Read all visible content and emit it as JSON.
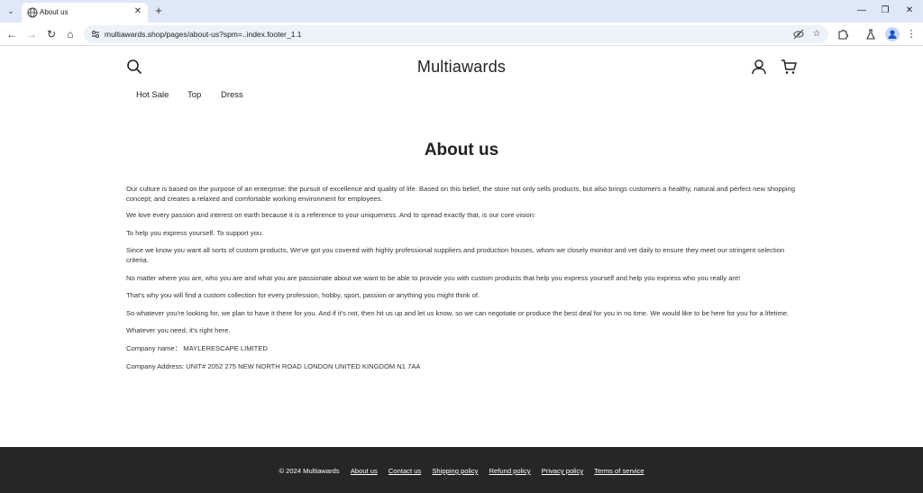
{
  "browser": {
    "tab": {
      "title": "About us"
    },
    "url": "multiawards.shop/pages/about-us?spm=..index.footer_1.1"
  },
  "header": {
    "store_name": "Multiawards",
    "nav": [
      "Hot Sale",
      "Top",
      "Dress"
    ]
  },
  "page": {
    "title": "About us",
    "paragraphs": [
      "Our culture is based on the purpose of an enterprise: the pursuit of excellence and quality of life. Based on this belief, the store not only sells products, but also brings customers a healthy, natural and perfect new shopping concept; and creates a relaxed and comfortable working environment for employees.",
      "We love every passion and interest on earth because it is a reference to your uniqueness. And to spread exactly that, is our core vision:",
      "To help you express yourself. To support you.",
      "Since we know you want all sorts of custom products, We've got you covered with highly professional suppliers and production houses, whom we closely monitor and vet daily to ensure they meet our stringent selection criteria.",
      "No matter where you are, who you are and what you are passionate about we want to be able to provide you with custom products that help you express yourself and help you express who you really are!",
      "That's why you will find a custom collection for every profession, hobby, sport, passion or anything you might think of.",
      "So whatever you're looking for, we plan to have it there for you. And if it's not, then hit us up and let us know, so we can negotiate or produce the best deal for you in no time. We would like to be here for you for a lifetime.",
      "Whatever you need, it's right here.",
      "Company name：  MAYLERESCAPE LIMITED",
      "Company Address: UNIT# 2052 275 NEW NORTH ROAD LONDON UNITED KINGDOM N1 7AA"
    ]
  },
  "footer": {
    "copyright": "© 2024 Multiawards",
    "links": [
      "About us",
      "Contact us",
      "Shipping policy",
      "Refund policy",
      "Privacy policy",
      "Terms of service"
    ]
  },
  "icons": {
    "tab_favicon": "globe-icon",
    "header_left": "search-icon",
    "header_right": [
      "account-icon",
      "cart-icon"
    ]
  }
}
